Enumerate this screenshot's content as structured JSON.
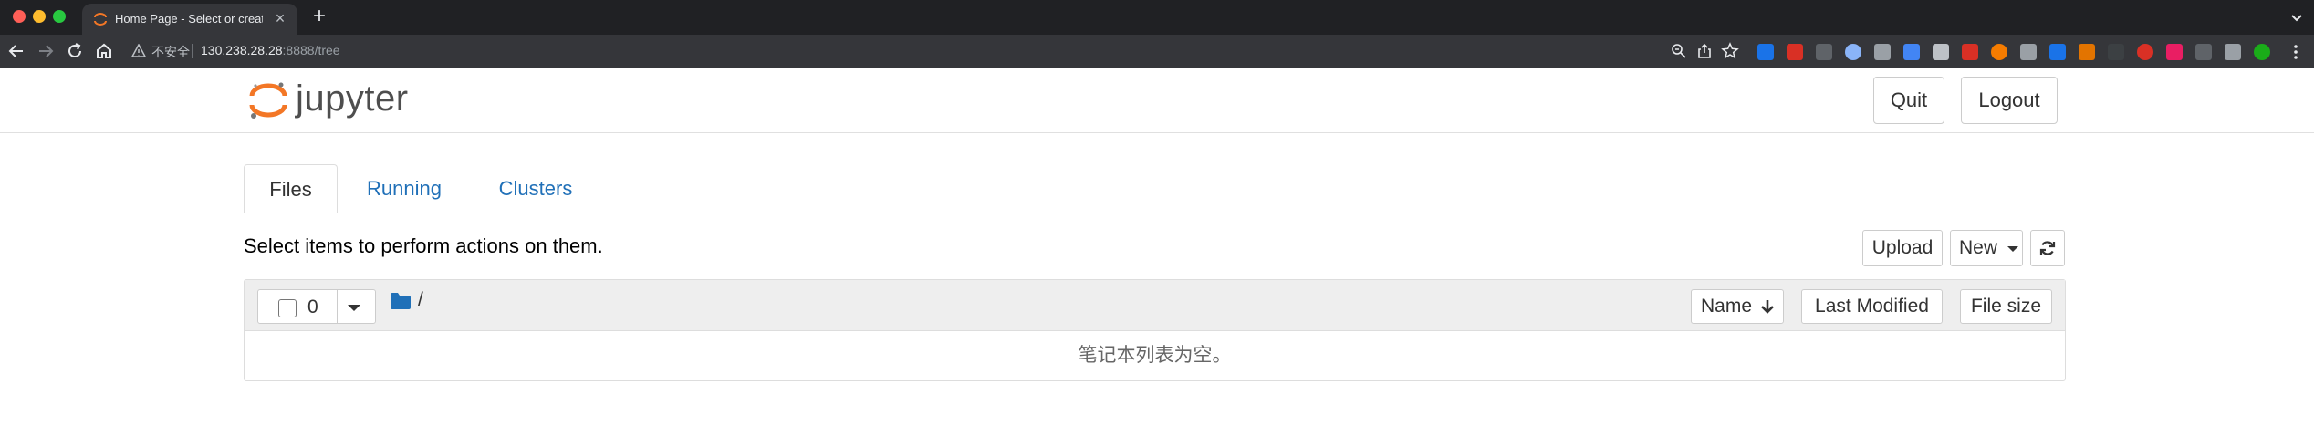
{
  "browser": {
    "tab_title": "Home Page - Select or create a notebook",
    "security_label": "不安全",
    "url_host": "130.238.28.28",
    "url_rest": ":8888/tree"
  },
  "app": {
    "logo_text": "jupyter",
    "quit_label": "Quit",
    "logout_label": "Logout"
  },
  "tabs": [
    {
      "label": "Files",
      "active": true
    },
    {
      "label": "Running",
      "active": false
    },
    {
      "label": "Clusters",
      "active": false
    }
  ],
  "toolbar": {
    "instructions": "Select items to perform actions on them.",
    "upload_label": "Upload",
    "new_label": "New"
  },
  "list": {
    "selected_count": "0",
    "path": "/",
    "columns": {
      "name": "Name",
      "last_modified": "Last Modified",
      "file_size": "File size"
    },
    "empty_message": "笔记本列表为空。"
  },
  "colors": {
    "accent_link": "#2070b8",
    "jupyter_orange": "#f37726",
    "folder_blue": "#2070b8"
  }
}
